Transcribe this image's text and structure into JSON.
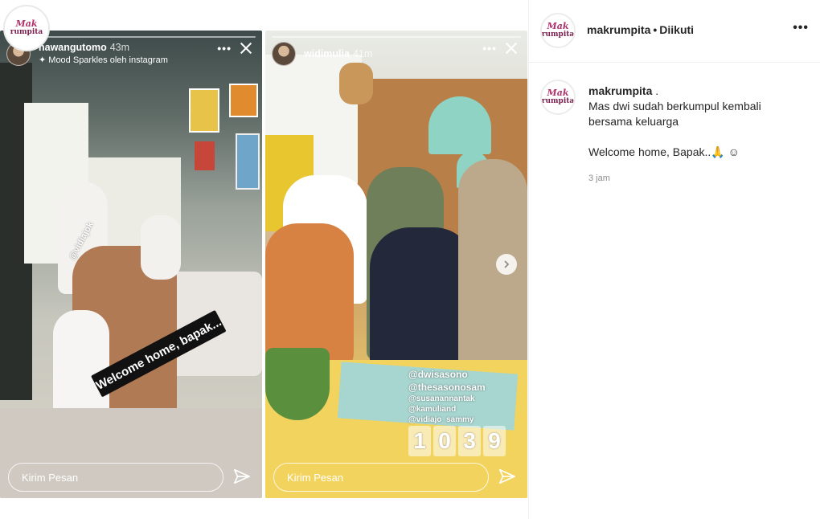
{
  "brand": {
    "logo_line1": "Mak",
    "logo_line2": "rumpita",
    "accent": "#b0306a"
  },
  "stories": [
    {
      "username": "nawangutomo",
      "time": "43m",
      "music": "Mood Sparkles oleh instagram",
      "mention": "@vidiajok",
      "sticker": "Welcome home, bapak...",
      "reply_placeholder": "Kirim Pesan"
    },
    {
      "username": "widimulia",
      "time": "41m",
      "mentions": [
        "@dwisasono",
        "@thesasonosam",
        "@susanannantak",
        "@kamuliand",
        "@vidiajo_sammy"
      ],
      "clock": [
        "1",
        "0",
        "3",
        "9"
      ],
      "reply_placeholder": "Kirim Pesan"
    }
  ],
  "post": {
    "username": "makrumpita",
    "separator": "•",
    "follow_status": "Diikuti",
    "caption_user": "makrumpita",
    "caption_user_suffix": " .",
    "caption_line1": "Mas dwi sudah berkumpul kembali",
    "caption_line2": "bersama keluarga",
    "caption_line3": "Welcome home, Bapak..🙏 ☺",
    "time": "3 jam"
  },
  "icons": {
    "more": "more-horizontal-icon",
    "close": "close-icon",
    "send": "send-icon",
    "next": "chevron-right-icon",
    "music": "sparkle-icon"
  }
}
